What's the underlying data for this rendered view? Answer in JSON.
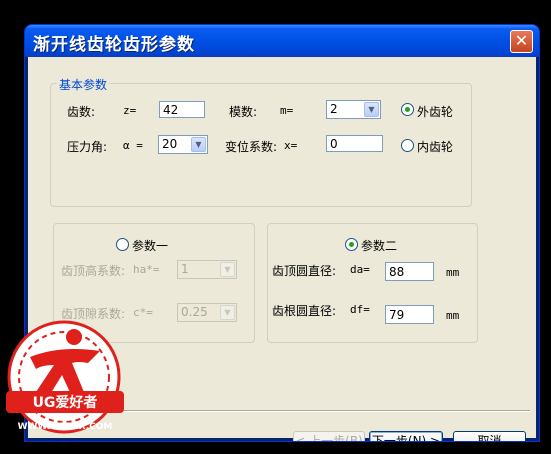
{
  "window": {
    "title": "渐开线齿轮齿形参数",
    "close_label": "✕"
  },
  "basic": {
    "legend": "基本参数",
    "teeth_label": "齿数:",
    "teeth_sym": "z=",
    "teeth_value": "42",
    "module_label": "模数:",
    "module_sym": "m=",
    "module_value": "2",
    "pressure_label": "压力角:",
    "pressure_sym": "α =",
    "pressure_value": "20",
    "shift_label": "变位系数:",
    "shift_sym": "x=",
    "shift_value": "0",
    "external_label": "外齿轮",
    "internal_label": "内齿轮"
  },
  "param1": {
    "radio_label": "参数一",
    "ha_label": "齿顶高系数:",
    "ha_sym": "ha*=",
    "ha_value": "1",
    "c_label": "齿顶隙系数:",
    "c_sym": "c*=",
    "c_value": "0.25"
  },
  "param2": {
    "radio_label": "参数二",
    "da_label": "齿顶圆直径:",
    "da_sym": "da=",
    "da_value": "88",
    "da_unit": "mm",
    "df_label": "齿根圆直径:",
    "df_sym": "df=",
    "df_value": "79",
    "df_unit": "mm"
  },
  "buttons": {
    "prev": "< 上一步(B)",
    "next": "下一步(N) >",
    "cancel": "取消"
  },
  "logo": {
    "brand": "UG爱好者",
    "url": "WWW.UGSNX.COM"
  },
  "colors": {
    "title_bar": "#0050e6",
    "dialog_bg": "#ece9d8",
    "accent": "#0046d5",
    "logo_red": "#e0201b"
  }
}
